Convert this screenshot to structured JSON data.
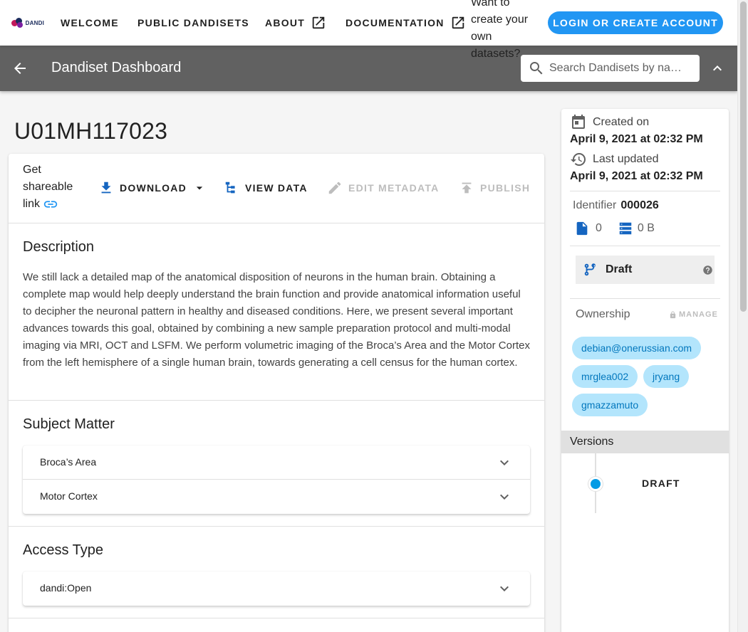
{
  "nav": {
    "logo_text": "DANDI",
    "items": [
      {
        "label": "Welcome"
      },
      {
        "label": "Public Dandisets"
      },
      {
        "label": "About"
      },
      {
        "label": "Documentation"
      }
    ],
    "create_prompt": "Want to create your own datasets?",
    "login_label": "Login or Create Account"
  },
  "appbar": {
    "title": "Dandiset Dashboard",
    "search_placeholder": "Search Dandisets by name, description, ID"
  },
  "dandiset": {
    "id_title": "U01MH117023",
    "share_label": "Get shareable link",
    "actions": {
      "download": "Download",
      "view_data": "View Data",
      "edit_metadata": "Edit Metadata",
      "publish": "Publish"
    },
    "description": {
      "heading": "Description",
      "text": "We still lack a detailed map of the anatomical disposition of neurons in the human brain. Obtaining a complete map would help deeply understand the brain function and provide anatomical information useful to decipher the neuronal pattern in healthy and diseased conditions. Here, we present several important advances towards this goal, obtained by combining a new sample preparation protocol and multi-modal imaging via MRI, OCT and LSFM. We perform volumetric imaging of the Broca’s Area and the Motor Cortex from the left hemisphere of a single human brain, towards generating a cell census for the human cortex."
    },
    "subject_matter": {
      "heading": "Subject Matter",
      "items": [
        "Broca’s Area",
        "Motor Cortex"
      ]
    },
    "access_type": {
      "heading": "Access Type",
      "items": [
        "dandi:Open"
      ]
    }
  },
  "sidebar": {
    "created_label": "Created on",
    "created_value": "April 9, 2021 at 02:32 PM",
    "updated_label": "Last updated",
    "updated_value": "April 9, 2021 at 02:32 PM",
    "identifier_label": "Identifier",
    "identifier_value": "000026",
    "file_count": "0",
    "size": "0 B",
    "status": "Draft",
    "ownership_label": "Ownership",
    "manage_label": "Manage",
    "owners": [
      "debian@onerussian.com",
      "mrglea002",
      "jryang",
      "gmazzamuto"
    ],
    "versions_label": "Versions",
    "version_items": [
      "Draft"
    ]
  },
  "colors": {
    "accent": "#2196f3",
    "appbar": "#616161",
    "chip_bg": "#b3e5fc",
    "chip_text": "#0277bd",
    "timeline_dot": "#039be5"
  },
  "icons": {
    "external": "open-in-new-icon",
    "search": "magnify-icon",
    "back": "arrow-left-icon"
  }
}
